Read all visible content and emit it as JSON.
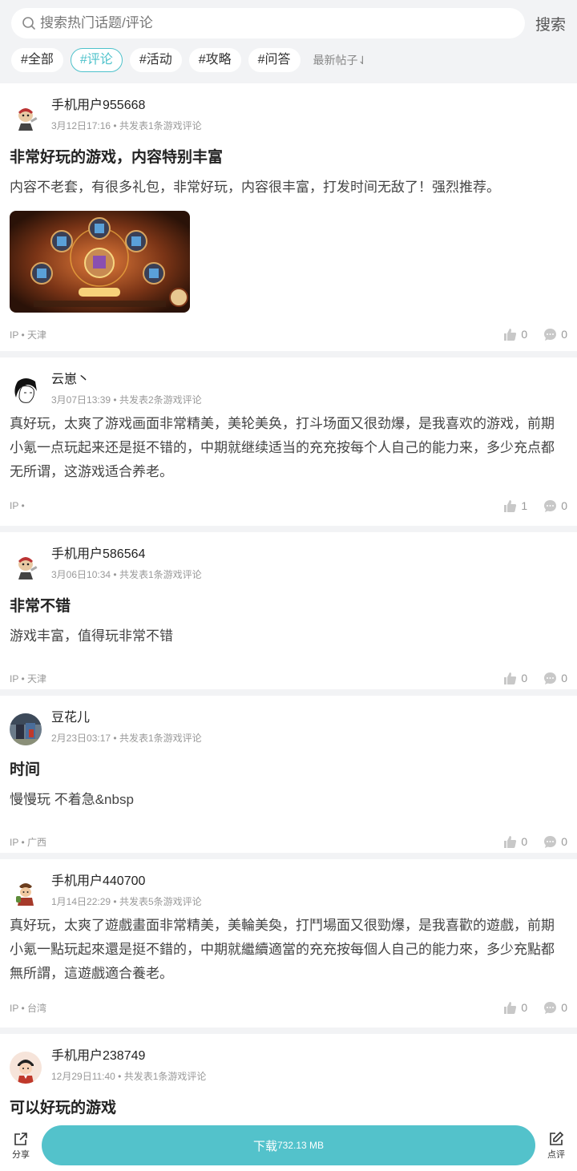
{
  "search": {
    "placeholder": "搜索热门话题/评论",
    "button_label": "搜索"
  },
  "tags": [
    {
      "label": "#全部",
      "active": false
    },
    {
      "label": "#评论",
      "active": true
    },
    {
      "label": "#活动",
      "active": false
    },
    {
      "label": "#攻略",
      "active": false
    },
    {
      "label": "#问答",
      "active": false
    }
  ],
  "sort_label": "最新帖子⇃",
  "posts": [
    {
      "username": "手机用户955668",
      "date": "3月12日17:16",
      "summary": "共发表1条游戏评论",
      "title": "非常好玩的游戏，内容特别丰富",
      "content": "内容不老套，有很多礼包，非常好玩，内容很丰富，打发时间无敌了！强烈推荐。",
      "has_image": true,
      "ip": "IP • 天津",
      "likes": "0",
      "comments": "0",
      "avatar": "cartoon-pirate"
    },
    {
      "username": "云崽丶",
      "date": "3月07日13:39",
      "summary": "共发表2条游戏评论",
      "title": "",
      "content": "真好玩，太爽了游戏画面非常精美，美轮美奂，打斗场面又很劲爆，是我喜欢的游戏，前期小氪一点玩起来还是挺不错的，中期就继续适当的充充按每个人自己的能力来，多少充点都无所谓，这游戏适合养老。",
      "has_image": false,
      "ip": "IP •",
      "likes": "1",
      "comments": "0",
      "avatar": "sketch-face"
    },
    {
      "username": "手机用户586564",
      "date": "3月06日10:34",
      "summary": "共发表1条游戏评论",
      "title": "非常不错",
      "content": "游戏丰富，值得玩非常不错",
      "has_image": false,
      "ip": "IP • 天津",
      "likes": "0",
      "comments": "0",
      "avatar": "cartoon-pirate"
    },
    {
      "username": "豆花儿",
      "date": "2月23日03:17",
      "summary": "共发表1条游戏评论",
      "title": "时间",
      "content": "慢慢玩 不着急&nbsp",
      "has_image": false,
      "ip": "IP • 广西",
      "likes": "0",
      "comments": "0",
      "avatar": "photo"
    },
    {
      "username": "手机用户440700",
      "date": "1月14日22:29",
      "summary": "共发表5条游戏评论",
      "title": "",
      "content": "真好玩，太爽了遊戲畫面非常精美，美輪美奐，打鬥場面又很勁爆，是我喜歡的遊戲，前期小氪一點玩起來還是挺不錯的，中期就繼續適當的充充按每個人自己的能力來，多少充點都無所謂，這遊戲適合養老。",
      "has_image": false,
      "ip": "IP • 台湾",
      "likes": "0",
      "comments": "0",
      "avatar": "cartoon-warrior"
    },
    {
      "username": "手机用户238749",
      "date": "12月29日11:40",
      "summary": "共发表1条游戏评论",
      "title": "可以好玩的游戏",
      "content": "",
      "has_image": false,
      "ip": "",
      "likes": "",
      "comments": "",
      "avatar": "cartoon-boy"
    }
  ],
  "bottom_bar": {
    "share_label": "分享",
    "download_label": "下载",
    "download_size": "732.13 MB",
    "review_label": "点评"
  },
  "colors": {
    "accent": "#53c2cb",
    "background": "#f2f3f5"
  }
}
